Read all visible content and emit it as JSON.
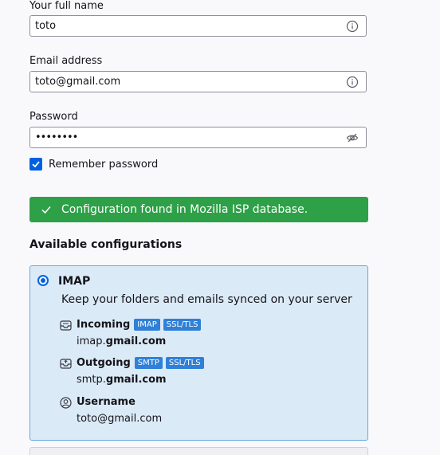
{
  "form": {
    "full_name_label": "Your full name",
    "full_name_value": "toto",
    "email_label": "Email address",
    "email_value": "toto@gmail.com",
    "password_label": "Password",
    "password_value": "••••••••",
    "remember_label": "Remember password",
    "remember_checked": true
  },
  "status": {
    "message": "Configuration found in Mozilla ISP database.",
    "color": "#2ea048"
  },
  "configs": {
    "section_title": "Available configurations",
    "selected": {
      "protocol": "IMAP",
      "description": "Keep your folders and emails synced on your server",
      "incoming": {
        "label": "Incoming",
        "badges": [
          "IMAP",
          "SSL/TLS"
        ],
        "host_prefix": "imap.",
        "host_domain": "gmail.com"
      },
      "outgoing": {
        "label": "Outgoing",
        "badges": [
          "SMTP",
          "SSL/TLS"
        ],
        "host_prefix": "smtp.",
        "host_domain": "gmail.com"
      },
      "username": {
        "label": "Username",
        "value": "toto@gmail.com"
      }
    }
  },
  "icons": {
    "name_info": "info-icon",
    "email_info": "info-icon",
    "password_toggle": "eye-slash-icon",
    "check": "checkmark-icon",
    "incoming": "inbox-icon",
    "outgoing": "outbox-icon",
    "username": "user-icon"
  },
  "colors": {
    "accent": "#0061e0",
    "card_bg": "#dbeaf7",
    "badge_bg": "#2f80d8"
  }
}
